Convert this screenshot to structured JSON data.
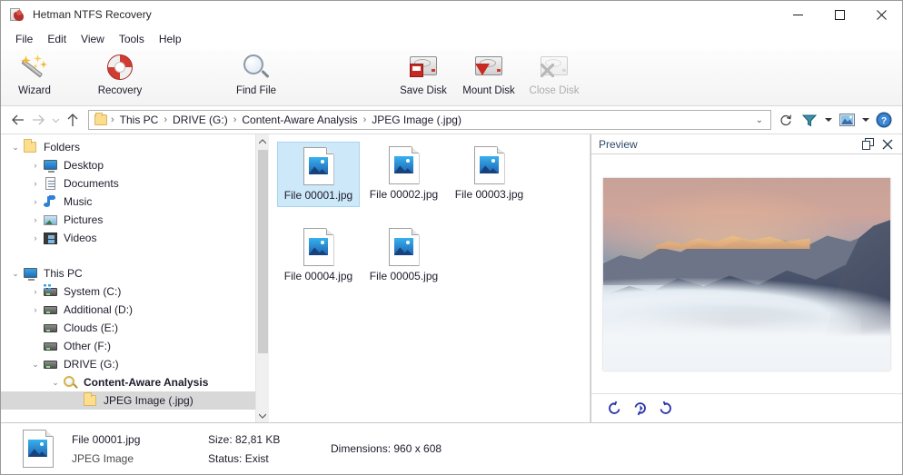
{
  "window": {
    "title": "Hetman NTFS Recovery",
    "app_icon": "app-logo-icon",
    "minimize": "–",
    "maximize": "□",
    "close": "✕"
  },
  "menubar": {
    "items": [
      {
        "label": "File"
      },
      {
        "label": "Edit"
      },
      {
        "label": "View"
      },
      {
        "label": "Tools"
      },
      {
        "label": "Help"
      }
    ]
  },
  "toolbar": {
    "items": [
      {
        "label": "Wizard",
        "icon": "magic-wand-icon",
        "enabled": true
      },
      {
        "label": "Recovery",
        "icon": "lifebuoy-icon",
        "enabled": true
      },
      {
        "label": "Find File",
        "icon": "magnifier-icon",
        "enabled": true
      },
      {
        "label": "Save Disk",
        "icon": "disk-save-icon",
        "enabled": true
      },
      {
        "label": "Mount Disk",
        "icon": "disk-mount-icon",
        "enabled": true
      },
      {
        "label": "Close Disk",
        "icon": "disk-close-icon",
        "enabled": false
      }
    ]
  },
  "addressbar": {
    "back": "back-arrow-icon",
    "forward": "forward-arrow-icon",
    "history": "history-chevron-icon",
    "up": "up-arrow-icon",
    "folder_icon": "folder-icon",
    "breadcrumbs": [
      {
        "label": "This PC"
      },
      {
        "label": "DRIVE (G:)"
      },
      {
        "label": "Content-Aware Analysis"
      },
      {
        "label": "JPEG Image (.jpg)"
      }
    ],
    "separator": "›",
    "dropdown_caret": "⌄",
    "refresh": "refresh-icon",
    "filter_icon": "filter-funnel-icon",
    "filter_caret": "▾",
    "view_icon": "view-thumbnails-icon",
    "view_caret": "▾",
    "help_icon": "help-icon"
  },
  "tree": {
    "groups": [
      {
        "label": "Folders",
        "icon": "folder-icon",
        "expander": "⌄",
        "children": [
          {
            "label": "Desktop",
            "icon": "monitor-icon",
            "expander": "›"
          },
          {
            "label": "Documents",
            "icon": "document-icon",
            "expander": "›"
          },
          {
            "label": "Music",
            "icon": "music-note-icon",
            "expander": "›"
          },
          {
            "label": "Pictures",
            "icon": "picture-icon",
            "expander": "›"
          },
          {
            "label": "Videos",
            "icon": "film-icon",
            "expander": "›"
          }
        ]
      },
      {
        "label": "This PC",
        "icon": "monitor-icon",
        "expander": "⌄",
        "children": [
          {
            "label": "System (C:)",
            "icon": "drive-system-icon",
            "expander": "›"
          },
          {
            "label": "Additional (D:)",
            "icon": "drive-icon",
            "expander": "›"
          },
          {
            "label": "Clouds (E:)",
            "icon": "drive-icon",
            "expander": ""
          },
          {
            "label": "Other (F:)",
            "icon": "drive-icon",
            "expander": ""
          },
          {
            "label": "DRIVE (G:)",
            "icon": "drive-icon",
            "expander": "⌄"
          },
          {
            "label": "Content-Aware Analysis",
            "icon": "search-folder-icon",
            "expander": "⌄",
            "bold": true
          },
          {
            "label": "JPEG Image (.jpg)",
            "icon": "folder-icon",
            "expander": "",
            "selected": true
          }
        ]
      }
    ],
    "scroll_up": "▲",
    "scroll_down": "▼"
  },
  "files": {
    "items": [
      {
        "name": "File 00001.jpg",
        "selected": true
      },
      {
        "name": "File 00002.jpg",
        "selected": false
      },
      {
        "name": "File 00003.jpg",
        "selected": false
      },
      {
        "name": "File 00004.jpg",
        "selected": false
      },
      {
        "name": "File 00005.jpg",
        "selected": false
      }
    ]
  },
  "preview": {
    "title": "Preview",
    "undock_icon": "undock-icon",
    "close_icon": "close-icon",
    "image_alt": "mountain-peaks-above-clouds-at-sunrise",
    "tools": [
      {
        "icon": "rotate-left-icon",
        "glyph": "↺"
      },
      {
        "icon": "rotate-180-icon",
        "glyph": "⟲"
      },
      {
        "icon": "rotate-right-icon",
        "glyph": "↻"
      }
    ]
  },
  "status": {
    "thumb_icon": "jpeg-file-icon",
    "file_name": "File 00001.jpg",
    "file_type": "JPEG Image",
    "size": "Size: 82,81 KB",
    "state": "Status: Exist",
    "dimensions": "Dimensions: 960 x 608"
  },
  "colors": {
    "selection_fill": "#cde8f9",
    "selection_border": "#a8d4ef",
    "tree_selection": "#d8d8d8",
    "accent_blue": "#2b35a8",
    "window_border": "#9a9a9a"
  }
}
